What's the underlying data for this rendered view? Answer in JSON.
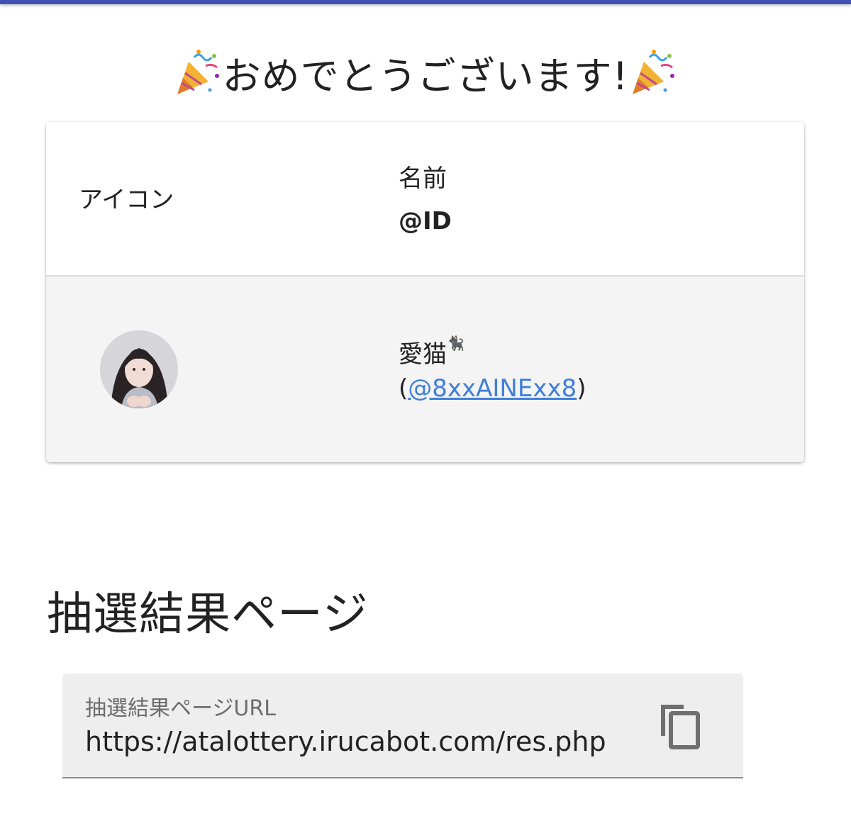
{
  "headline": {
    "text": "おめでとうございます!",
    "left_icon": "party-popper-icon",
    "right_icon": "party-popper-icon"
  },
  "table": {
    "header": {
      "icon_label": "アイコン",
      "name_label": "名前",
      "id_label": "@ID"
    },
    "rows": [
      {
        "avatar": "user-avatar-photo",
        "name": "愛猫",
        "name_suffix_icon": "cat-emoji-icon",
        "id_open": "(",
        "id_handle": "@8xxAINExx8",
        "id_close": ")"
      }
    ]
  },
  "section": {
    "title": "抽選結果ページ"
  },
  "url_field": {
    "label": "抽選結果ページURL",
    "value": "https://atalottery.irucabot.com/res.php",
    "action_icon": "copy-icon"
  },
  "colors": {
    "top_bar": "#3f51b5",
    "link": "#3f7fd9",
    "row_background": "#f4f4f4",
    "field_background": "#eeeeee"
  }
}
